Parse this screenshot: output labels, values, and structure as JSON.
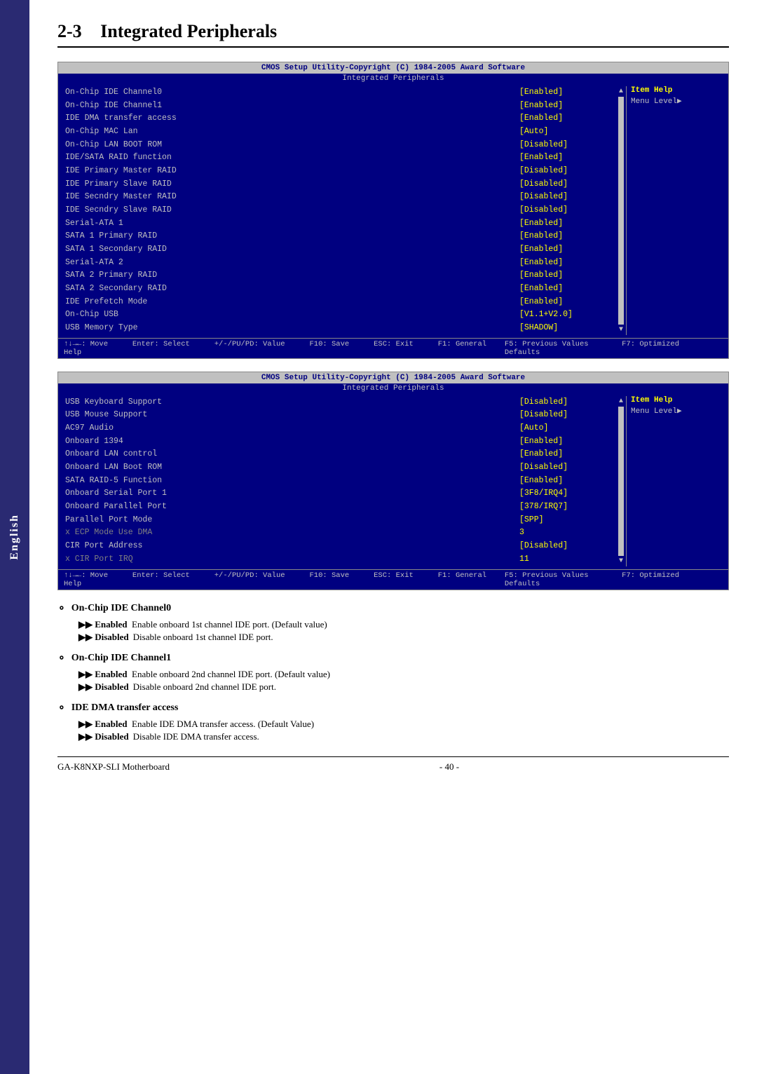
{
  "sidebar": {
    "label": "English"
  },
  "chapter": {
    "number": "2-3",
    "title": "Integrated Peripherals"
  },
  "bios_screen1": {
    "title": "CMOS Setup Utility-Copyright (C) 1984-2005 Award Software",
    "subtitle": "Integrated Peripherals",
    "rows": [
      {
        "label": "On-Chip IDE Channel0",
        "value": "[Enabled]",
        "highlighted": false
      },
      {
        "label": "On-Chip IDE Channel1",
        "value": "[Enabled]",
        "highlighted": false
      },
      {
        "label": "IDE DMA transfer access",
        "value": "[Enabled]",
        "highlighted": false
      },
      {
        "label": "On-Chip MAC Lan",
        "value": "[Auto]",
        "highlighted": false
      },
      {
        "label": "On-Chip LAN BOOT ROM",
        "value": "[Disabled]",
        "highlighted": false
      },
      {
        "label": "IDE/SATA RAID function",
        "value": "[Enabled]",
        "highlighted": false
      },
      {
        "label": "IDE Primary Master RAID",
        "value": "[Disabled]",
        "highlighted": false
      },
      {
        "label": "IDE Primary Slave RAID",
        "value": "[Disabled]",
        "highlighted": false
      },
      {
        "label": "IDE Secndry Master RAID",
        "value": "[Disabled]",
        "highlighted": false
      },
      {
        "label": "IDE Secndry Slave RAID",
        "value": "[Disabled]",
        "highlighted": false
      },
      {
        "label": "Serial-ATA 1",
        "value": "[Enabled]",
        "highlighted": false
      },
      {
        "label": "SATA 1 Primary RAID",
        "value": "[Enabled]",
        "highlighted": false
      },
      {
        "label": "SATA 1 Secondary RAID",
        "value": "[Enabled]",
        "highlighted": false
      },
      {
        "label": "Serial-ATA 2",
        "value": "[Enabled]",
        "highlighted": false
      },
      {
        "label": "SATA 2 Primary RAID",
        "value": "[Enabled]",
        "highlighted": false
      },
      {
        "label": "SATA 2 Secondary RAID",
        "value": "[Enabled]",
        "highlighted": false
      },
      {
        "label": "IDE Prefetch Mode",
        "value": "[Enabled]",
        "highlighted": false
      },
      {
        "label": "On-Chip USB",
        "value": "[V1.1+V2.0]",
        "highlighted": false
      },
      {
        "label": "USB Memory Type",
        "value": "[SHADOW]",
        "highlighted": false
      }
    ],
    "help": {
      "title": "Item Help",
      "menu_level": "Menu Level▶"
    },
    "footer": {
      "move": "↑↓→←: Move",
      "enter": "Enter: Select",
      "value": "+/-/PU/PD: Value",
      "f10": "F10: Save",
      "esc": "ESC: Exit",
      "f1": "F1: General Help",
      "f5": "F5: Previous Values",
      "f7": "F7: Optimized Defaults"
    }
  },
  "bios_screen2": {
    "title": "CMOS Setup Utility-Copyright (C) 1984-2005 Award Software",
    "subtitle": "Integrated Peripherals",
    "rows": [
      {
        "label": "USB Keyboard Support",
        "value": "[Disabled]",
        "highlighted": false,
        "grayed": false
      },
      {
        "label": "USB Mouse Support",
        "value": "[Disabled]",
        "highlighted": false,
        "grayed": false
      },
      {
        "label": "AC97 Audio",
        "value": "[Auto]",
        "highlighted": false,
        "grayed": false
      },
      {
        "label": "Onboard 1394",
        "value": "[Enabled]",
        "highlighted": false,
        "grayed": false
      },
      {
        "label": "Onboard LAN control",
        "value": "[Enabled]",
        "highlighted": false,
        "grayed": false
      },
      {
        "label": "Onboard LAN Boot ROM",
        "value": "[Disabled]",
        "highlighted": false,
        "grayed": false
      },
      {
        "label": "SATA RAID-5 Function",
        "value": "[Enabled]",
        "highlighted": false,
        "grayed": false
      },
      {
        "label": "Onboard Serial Port 1",
        "value": "[3F8/IRQ4]",
        "highlighted": false,
        "grayed": false
      },
      {
        "label": "Onboard Parallel Port",
        "value": "[378/IRQ7]",
        "highlighted": false,
        "grayed": false
      },
      {
        "label": "Parallel Port Mode",
        "value": "[SPP]",
        "highlighted": false,
        "grayed": false
      },
      {
        "label": "x  ECP Mode Use DMA",
        "value": "3",
        "highlighted": false,
        "grayed": true
      },
      {
        "label": "CIR Port Address",
        "value": "[Disabled]",
        "highlighted": false,
        "grayed": false
      },
      {
        "label": "x  CIR Port IRQ",
        "value": "11",
        "highlighted": false,
        "grayed": true
      }
    ],
    "help": {
      "title": "Item Help",
      "menu_level": "Menu Level▶"
    },
    "footer": {
      "move": "↑↓→←: Move",
      "enter": "Enter: Select",
      "value": "+/-/PU/PD: Value",
      "f10": "F10: Save",
      "esc": "ESC: Exit",
      "f1": "F1: General Help",
      "f5": "F5: Previous Values",
      "f7": "F7: Optimized Defaults"
    }
  },
  "descriptions": [
    {
      "id": "on-chip-ide-channel0",
      "heading": "On-Chip IDE Channel0",
      "items": [
        {
          "bullet": "▶▶ Enabled",
          "text": "Enable onboard 1st channel IDE port. (Default value)"
        },
        {
          "bullet": "▶▶ Disabled",
          "text": "Disable onboard 1st channel IDE port."
        }
      ]
    },
    {
      "id": "on-chip-ide-channel1",
      "heading": "On-Chip IDE Channel1",
      "items": [
        {
          "bullet": "▶▶ Enabled",
          "text": "Enable onboard 2nd channel IDE port. (Default value)"
        },
        {
          "bullet": "▶▶ Disabled",
          "text": "Disable onboard 2nd channel IDE port."
        }
      ]
    },
    {
      "id": "ide-dma-transfer-access",
      "heading": "IDE DMA transfer access",
      "items": [
        {
          "bullet": "▶▶ Enabled",
          "text": "Enable IDE DMA transfer access. (Default Value)"
        },
        {
          "bullet": "▶▶ Disabled",
          "text": "Disable IDE DMA transfer access."
        }
      ]
    }
  ],
  "footer": {
    "left": "GA-K8NXP-SLI Motherboard",
    "center": "- 40 -",
    "right": ""
  }
}
